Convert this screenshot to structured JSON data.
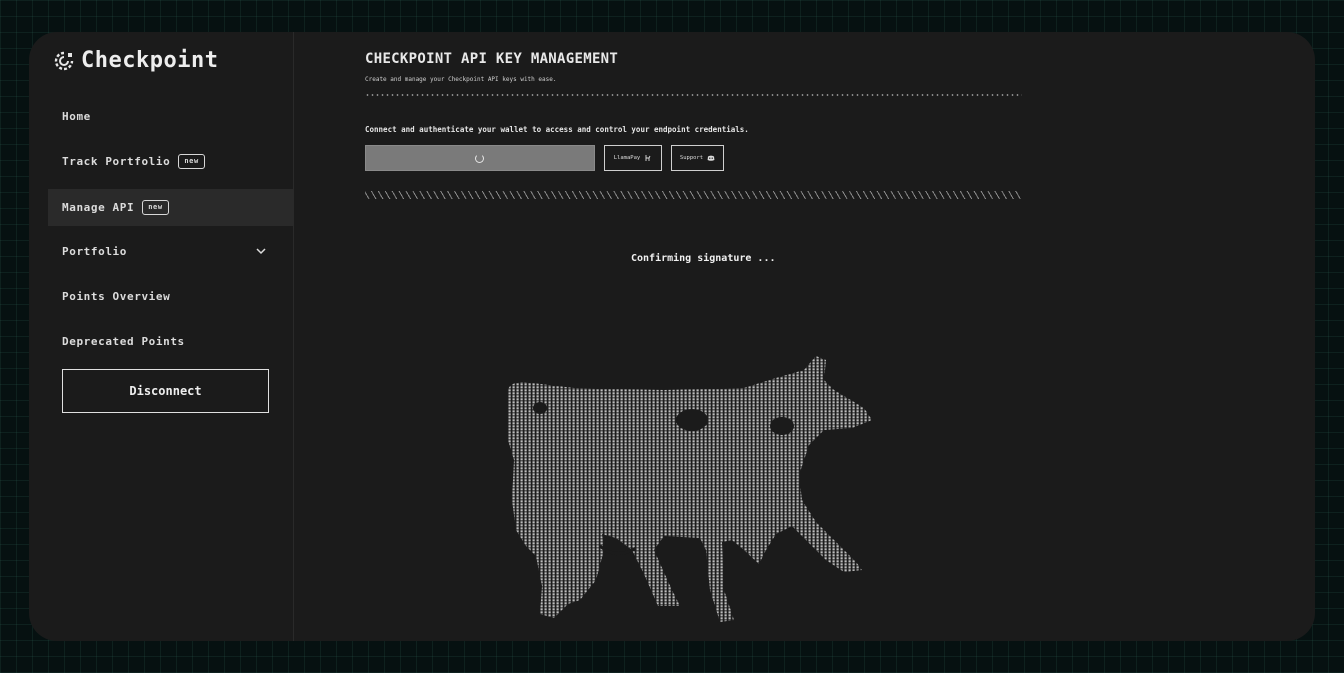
{
  "app": {
    "name": "Checkpoint"
  },
  "sidebar": {
    "items": [
      {
        "label": "Home"
      },
      {
        "label": "Track Portfolio",
        "badge": "new"
      },
      {
        "label": "Manage API",
        "badge": "new",
        "active": true
      },
      {
        "label": "Portfolio",
        "has_dropdown": true
      },
      {
        "label": "Points Overview"
      },
      {
        "label": "Deprecated Points"
      }
    ],
    "disconnect_label": "Disconnect"
  },
  "main": {
    "title": "CHECKPOINT API KEY MANAGEMENT",
    "subtitle": "Create and manage your Checkpoint API keys with ease.",
    "lead": "Connect and authenticate your wallet to access and control your endpoint credentials.",
    "llamapay_label": "LlamaPay",
    "support_label": "Support",
    "status_text": "Confirming signature ..."
  },
  "icons": {
    "brand": "checkpoint-logo-icon",
    "loading": "spinner-icon",
    "llamapay": "llama-icon",
    "support": "discord-icon",
    "dropdown": "chevron-down-icon",
    "illustration": "ascii-cow"
  },
  "colors": {
    "page_bg": "#061111",
    "panel_bg": "#1b1b1b",
    "active_item_bg": "#2a2a2a",
    "connect_button_bg": "#7a7a7a",
    "text": "#e8e8e8"
  }
}
